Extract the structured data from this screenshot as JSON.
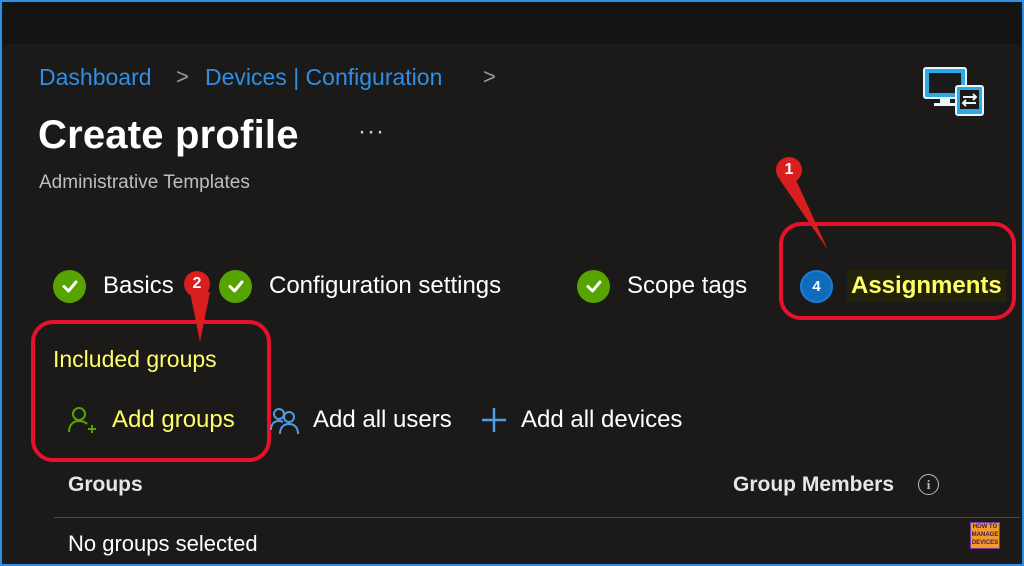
{
  "breadcrumb": {
    "items": [
      "Dashboard",
      "Devices | Configuration"
    ],
    "separator": ">"
  },
  "page": {
    "title": "Create profile",
    "more_label": "···",
    "subtitle": "Administrative Templates"
  },
  "wizard": {
    "steps": [
      {
        "label": "Basics",
        "status": "complete"
      },
      {
        "label": "Configuration settings",
        "status": "complete"
      },
      {
        "label": "Scope tags",
        "status": "complete"
      },
      {
        "label": "Assignments",
        "status": "active",
        "number": "4"
      }
    ]
  },
  "assignments": {
    "section_label": "Included groups",
    "commands": {
      "add_groups": "Add groups",
      "add_all_users": "Add all users",
      "add_all_devices": "Add all devices"
    },
    "columns": {
      "groups": "Groups",
      "group_members": "Group Members"
    },
    "empty_text": "No groups selected"
  },
  "annotations": {
    "callout_1": "1",
    "callout_2": "2"
  },
  "watermark": {
    "text": "HOW TO MANAGE DEVICES"
  },
  "colors": {
    "accent_blue": "#2f8fe6",
    "highlight_yellow": "#ffff66",
    "annotation_red": "#e8112d",
    "check_green": "#57a300",
    "background": "#1b1a19"
  }
}
